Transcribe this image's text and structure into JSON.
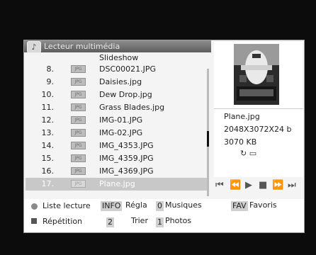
{
  "window": {
    "title": "Lecteur multimédia",
    "icon": "media-app-icon"
  },
  "list": {
    "header": "Slideshow",
    "items": [
      {
        "num": "8.",
        "name": "DSC00021.JPG"
      },
      {
        "num": "9.",
        "name": "Daisies.jpg"
      },
      {
        "num": "10.",
        "name": "Dew Drop.jpg"
      },
      {
        "num": "11.",
        "name": "Grass Blades.jpg"
      },
      {
        "num": "12.",
        "name": "IMG-01.JPG"
      },
      {
        "num": "13.",
        "name": "IMG-02.JPG"
      },
      {
        "num": "14.",
        "name": "IMG_4353.JPG"
      },
      {
        "num": "15.",
        "name": "IMG_4359.JPG"
      },
      {
        "num": "16.",
        "name": "IMG_4369.JPG"
      },
      {
        "num": "17.",
        "name": "Plane.jpg"
      }
    ],
    "selected_index": 9
  },
  "preview": {
    "filename": "Plane.jpg",
    "resolution": "2048X3072X24 b",
    "size": "3070 KB"
  },
  "controls": [
    "rewind-to-start-icon",
    "rewind-icon",
    "play-icon",
    "stop-icon",
    "fast-forward-icon",
    "skip-to-end-icon"
  ],
  "footer": {
    "playlist_label": "Liste lecture",
    "info_key": "INFO",
    "settings_label": "Régla",
    "key_0": "0",
    "music_label": "Musiques",
    "fav_key": "FAV",
    "favorites_label": "Favoris",
    "repeat_label": "Répétition",
    "key_2": "2",
    "sort_label": "Trier",
    "key_1": "1",
    "photos_label": "Photos"
  }
}
